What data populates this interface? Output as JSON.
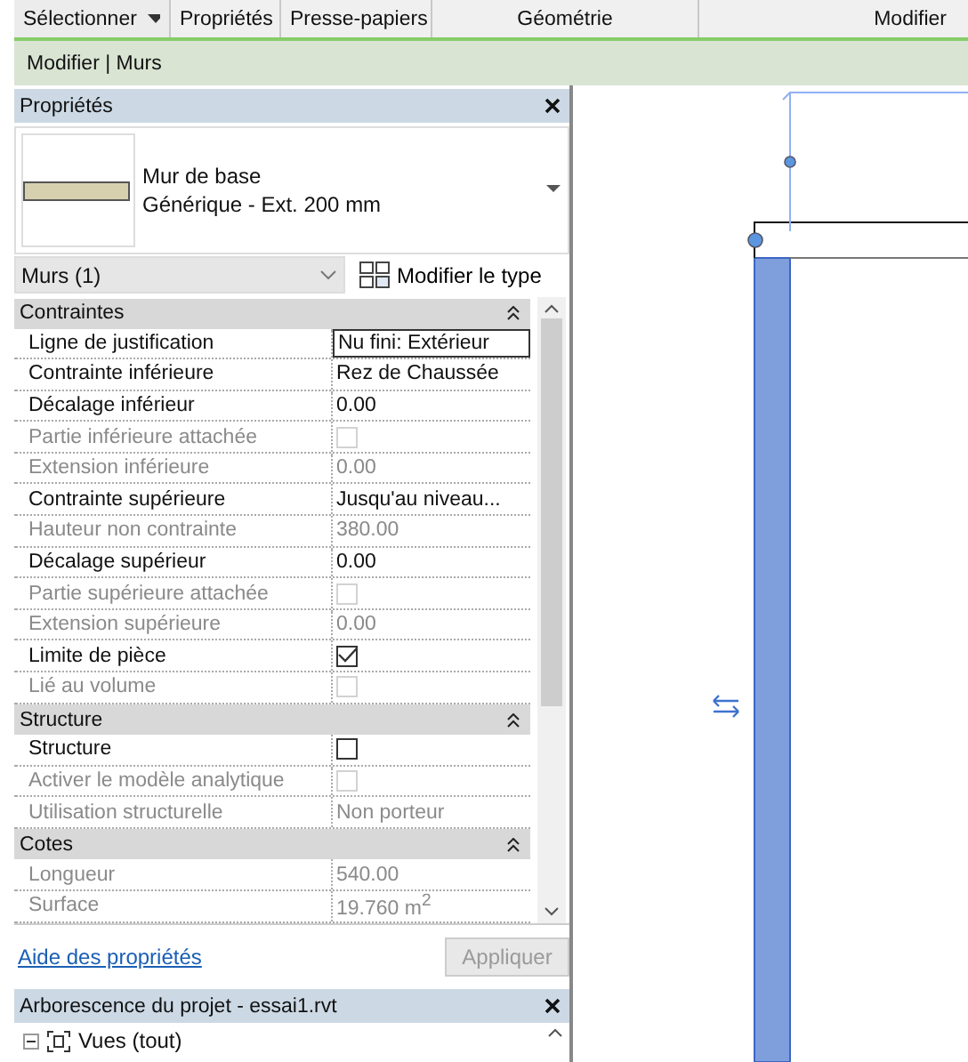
{
  "ribbon_panels": [
    {
      "label": "Sélectionner",
      "dropdown": true
    },
    {
      "label": "Propriétés"
    },
    {
      "label": "Presse-papiers"
    },
    {
      "label": "Géométrie"
    },
    {
      "label": "Modifier"
    }
  ],
  "context_bar": {
    "title": "Modifier | Murs"
  },
  "properties": {
    "title": "Propriétés",
    "type_selector": {
      "family": "Mur de base",
      "type": "Générique - Ext. 200 mm"
    },
    "filter": {
      "value": "Murs (1)"
    },
    "edit_type_button": "Modifier le type",
    "sections": [
      {
        "title": "Contraintes",
        "rows": [
          {
            "label": "Ligne de justification",
            "kind": "text",
            "value": "Nu fini: Extérieur",
            "disabled": false,
            "selected": true
          },
          {
            "label": "Contrainte inférieure",
            "kind": "text",
            "value": "Rez de Chaussée",
            "disabled": false,
            "selected": false
          },
          {
            "label": "Décalage inférieur",
            "kind": "text",
            "value": "0.00",
            "disabled": false,
            "selected": false
          },
          {
            "label": "Partie inférieure attachée",
            "kind": "checkbox",
            "checked": false,
            "disabled": true,
            "selected": false
          },
          {
            "label": "Extension inférieure",
            "kind": "text",
            "value": "0.00",
            "disabled": true,
            "selected": false
          },
          {
            "label": "Contrainte supérieure",
            "kind": "text",
            "value": "Jusqu'au niveau...",
            "disabled": false,
            "selected": false
          },
          {
            "label": "Hauteur non contrainte",
            "kind": "text",
            "value": "380.00",
            "disabled": true,
            "selected": false
          },
          {
            "label": "Décalage supérieur",
            "kind": "text",
            "value": "0.00",
            "disabled": false,
            "selected": false
          },
          {
            "label": "Partie supérieure attachée",
            "kind": "checkbox",
            "checked": false,
            "disabled": true,
            "selected": false
          },
          {
            "label": "Extension supérieure",
            "kind": "text",
            "value": "0.00",
            "disabled": true,
            "selected": false
          },
          {
            "label": "Limite de pièce",
            "kind": "checkbox",
            "checked": true,
            "disabled": false,
            "selected": false
          },
          {
            "label": "Lié au volume",
            "kind": "checkbox",
            "checked": false,
            "disabled": true,
            "selected": false
          }
        ]
      },
      {
        "title": "Structure",
        "rows": [
          {
            "label": "Structure",
            "kind": "checkbox",
            "checked": false,
            "disabled": false,
            "selected": false
          },
          {
            "label": "Activer le modèle analytique",
            "kind": "checkbox",
            "checked": false,
            "disabled": true,
            "selected": false
          },
          {
            "label": "Utilisation structurelle",
            "kind": "text",
            "value": "Non porteur",
            "disabled": true,
            "selected": false
          }
        ]
      },
      {
        "title": "Cotes",
        "rows": [
          {
            "label": "Longueur",
            "kind": "text",
            "value": "540.00",
            "disabled": true,
            "selected": false
          },
          {
            "label": "Surface",
            "kind": "text",
            "value": "19.760 m$^{2}$",
            "disabled": true,
            "selected": false
          }
        ]
      }
    ],
    "help_link": "Aide des propriétés",
    "apply_button": {
      "label": "Appliquer",
      "disabled": true
    }
  },
  "project_browser": {
    "title": "Arborescence du projet - essai1.rvt",
    "items": [
      {
        "label": "Vues (tout)",
        "expanded": true
      }
    ]
  }
}
